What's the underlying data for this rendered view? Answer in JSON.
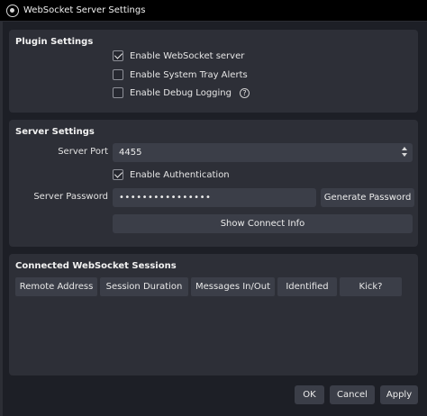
{
  "window": {
    "title": "WebSocket Server Settings"
  },
  "plugin_settings": {
    "title": "Plugin Settings",
    "enable_server": {
      "label": "Enable WebSocket server",
      "checked": true
    },
    "tray_alerts": {
      "label": "Enable System Tray Alerts",
      "checked": false
    },
    "debug_logging": {
      "label": "Enable Debug Logging",
      "checked": false,
      "help_icon": "question-circle-icon"
    }
  },
  "server_settings": {
    "title": "Server Settings",
    "port_label": "Server Port",
    "port_value": "4455",
    "auth": {
      "label": "Enable Authentication",
      "checked": true
    },
    "password_label": "Server Password",
    "password_value": "••••••••••••••••",
    "generate_label": "Generate Password",
    "connect_info_label": "Show Connect Info"
  },
  "sessions": {
    "title": "Connected WebSocket Sessions",
    "columns": [
      "Remote Address",
      "Session Duration",
      "Messages In/Out",
      "Identified",
      "Kick?"
    ]
  },
  "footer": {
    "ok": "OK",
    "cancel": "Cancel",
    "apply": "Apply"
  }
}
